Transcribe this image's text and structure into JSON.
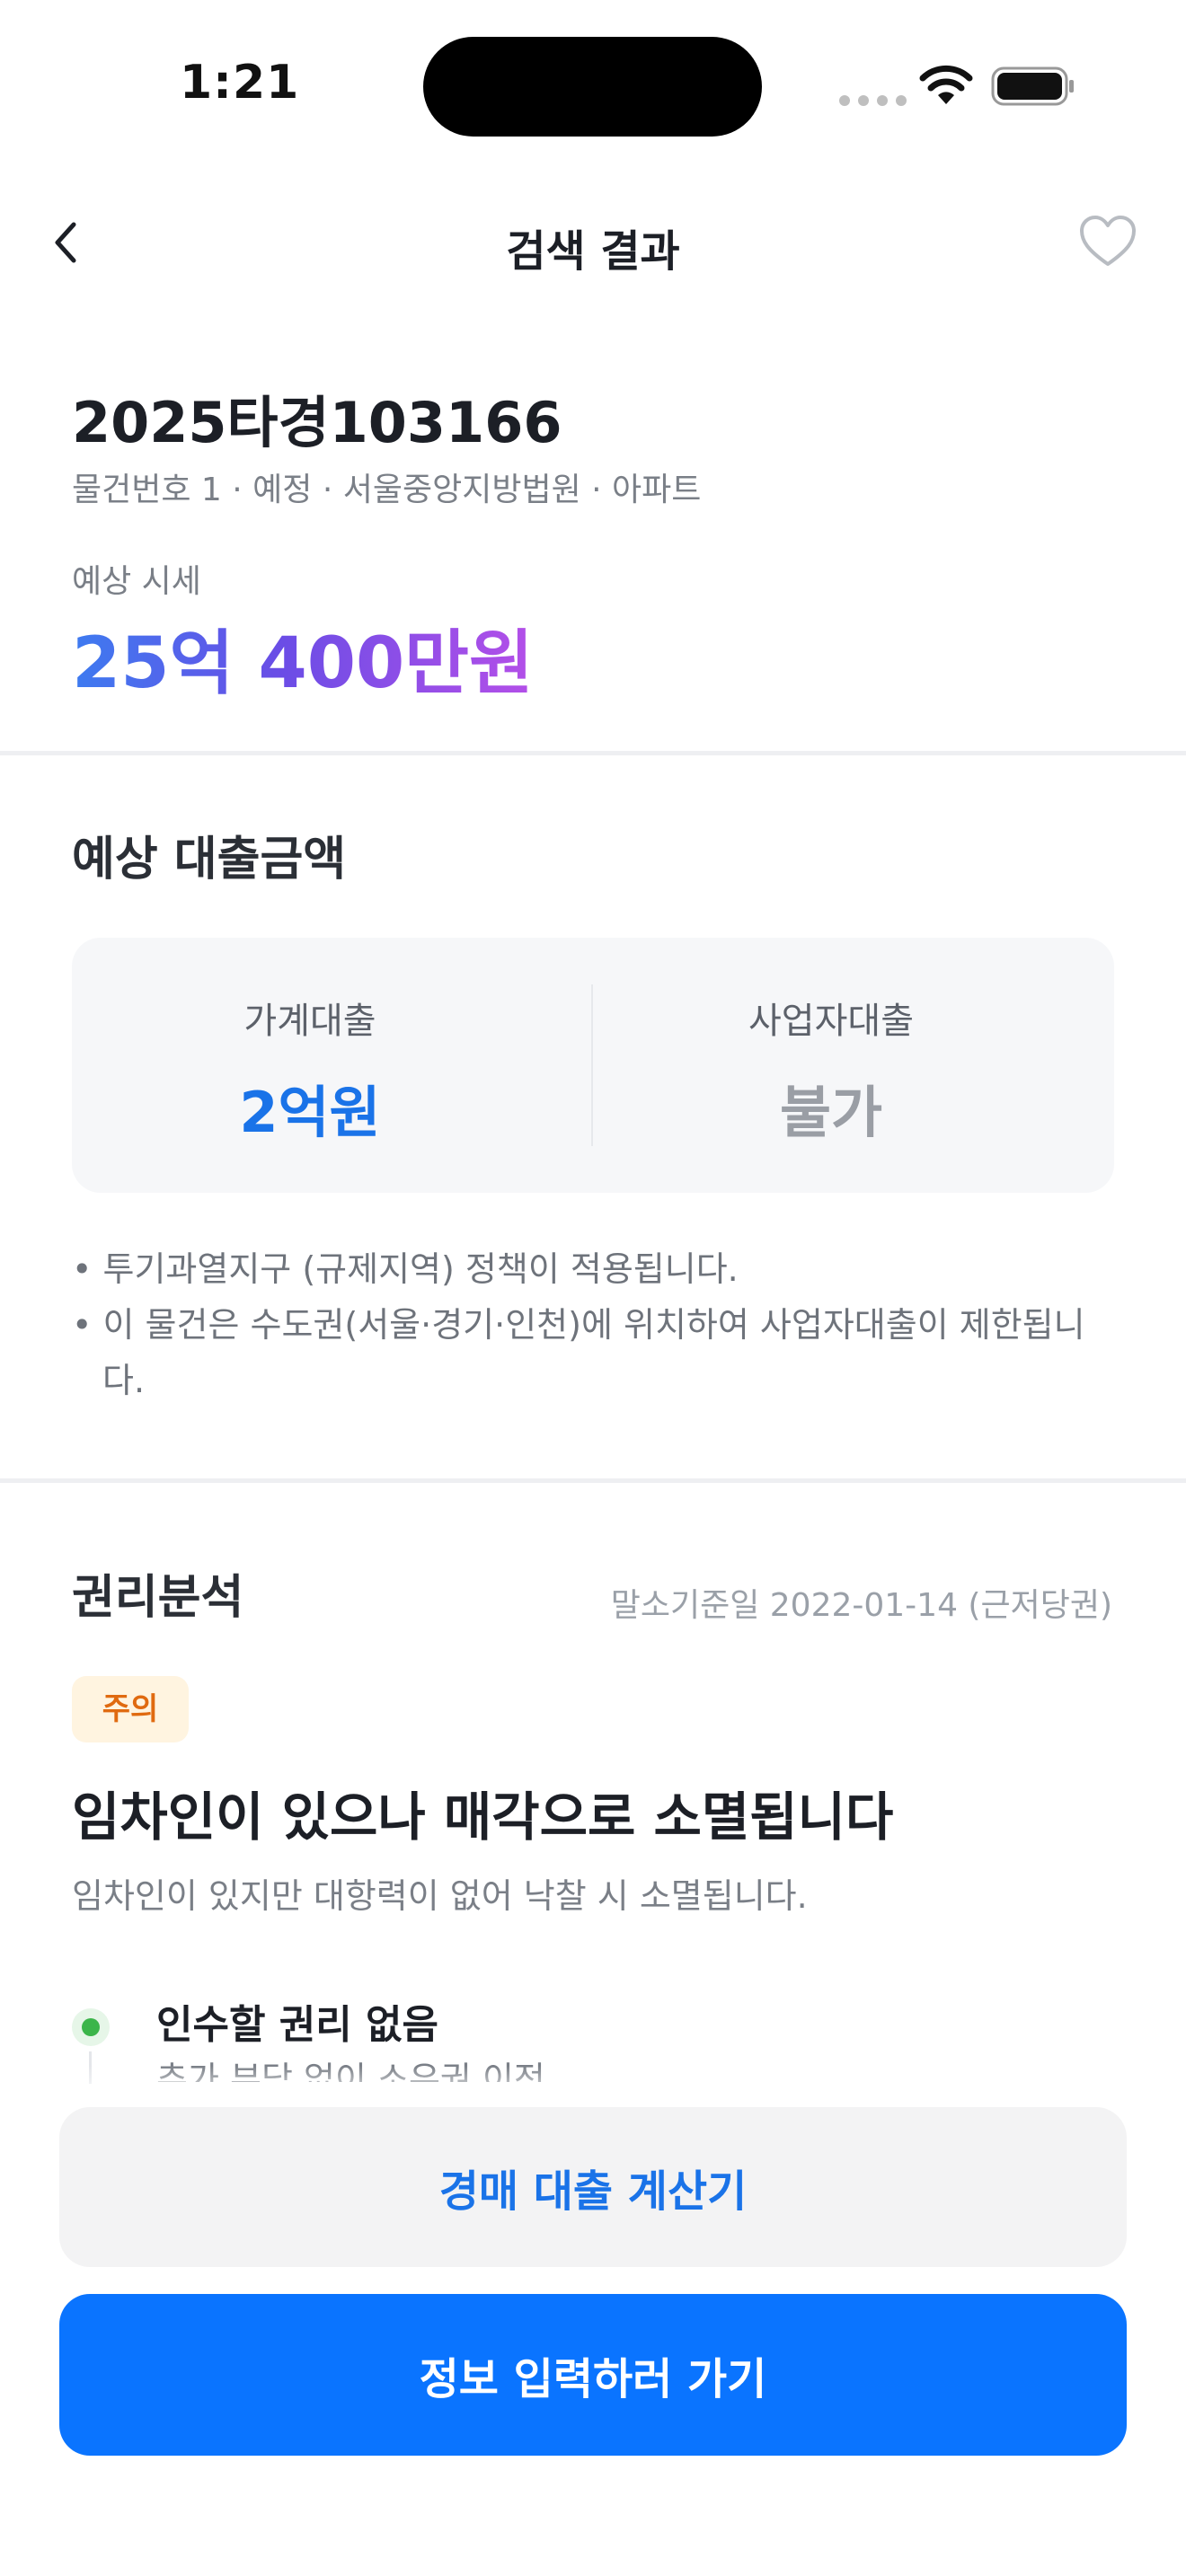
{
  "status_bar": {
    "time": "1:21"
  },
  "nav": {
    "title": "검색 결과"
  },
  "property": {
    "case_number": "2025타경103166",
    "meta": "물건번호 1 · 예정 · 서울중앙지방법원 · 아파트",
    "price_label": "예상 시세",
    "price_value": "25억 400만원"
  },
  "loan": {
    "section_title": "예상 대출금액",
    "household_label": "가계대출",
    "household_value": "2억원",
    "business_label": "사업자대출",
    "business_value": "불가",
    "notes": [
      "• 투기과열지구 (규제지역) 정책이 적용됩니다.",
      "• 이 물건은 수도권(서울·경기·인천)에 위치하여 사업자대출이 제한됩니다."
    ]
  },
  "rights": {
    "section_title": "권리분석",
    "base_date": "말소기준일 2022-01-14 (근저당권)",
    "badge": "주의",
    "headline": "임차인이 있으나 매각으로 소멸됩니다",
    "description": "임차인이 있지만 대항력이 없어 낙찰 시 소멸됩니다.",
    "item_title": "인수할 권리 없음",
    "item_desc": "추가 부담 없이 소유권 이전"
  },
  "buttons": {
    "calculator": "경매 대출 계산기",
    "input_info": "정보 입력하러 가기"
  },
  "colors": {
    "primary": "#0a74ff",
    "household_value": "#1a73e8",
    "business_value": "#9a9ea5",
    "badge_text": "#e06a10",
    "badge_bg": "#fff4e0",
    "timeline_dot": "#3bb54a"
  }
}
